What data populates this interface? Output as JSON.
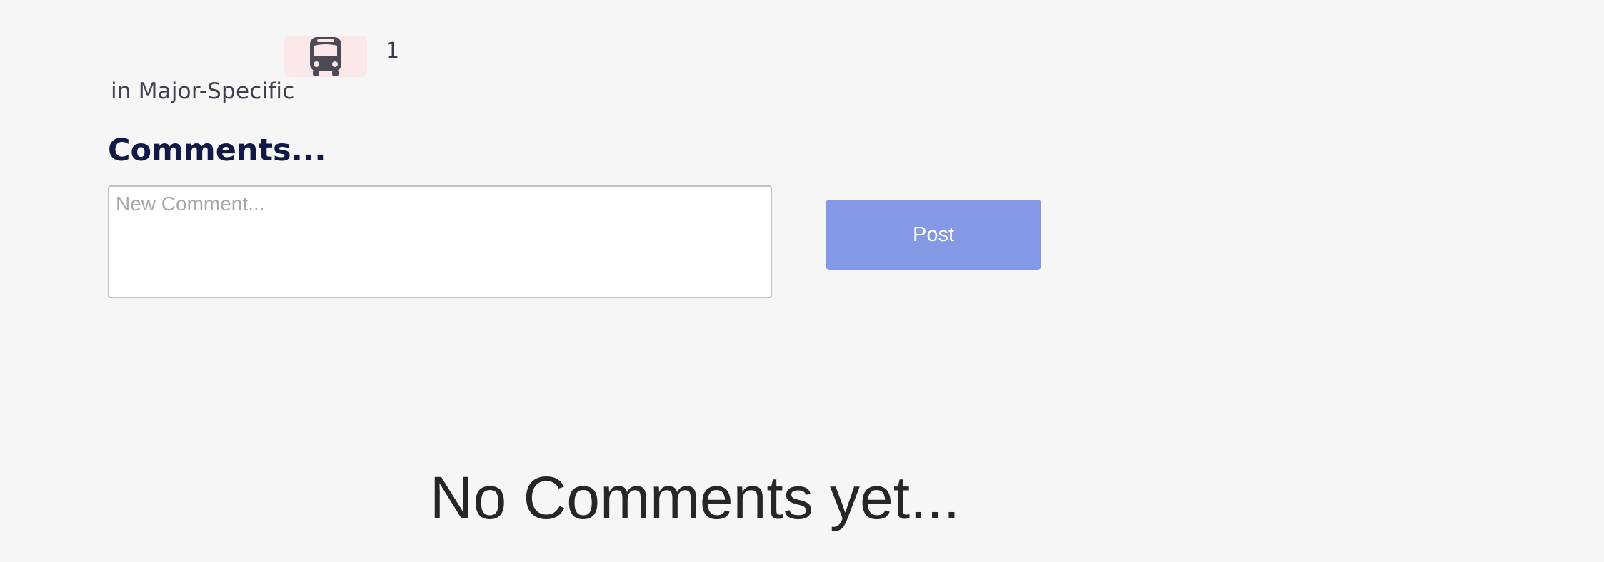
{
  "post": {
    "reaction": {
      "icon": "bus-icon",
      "badge_color": "#fbe9e9",
      "count": "1"
    },
    "category_text": "in Major-Specific"
  },
  "comments": {
    "heading": "Comments...",
    "input_placeholder": "New Comment...",
    "input_value": "",
    "post_button_label": "Post",
    "post_button_color": "#8499e6",
    "empty_message": "No Comments yet..."
  }
}
